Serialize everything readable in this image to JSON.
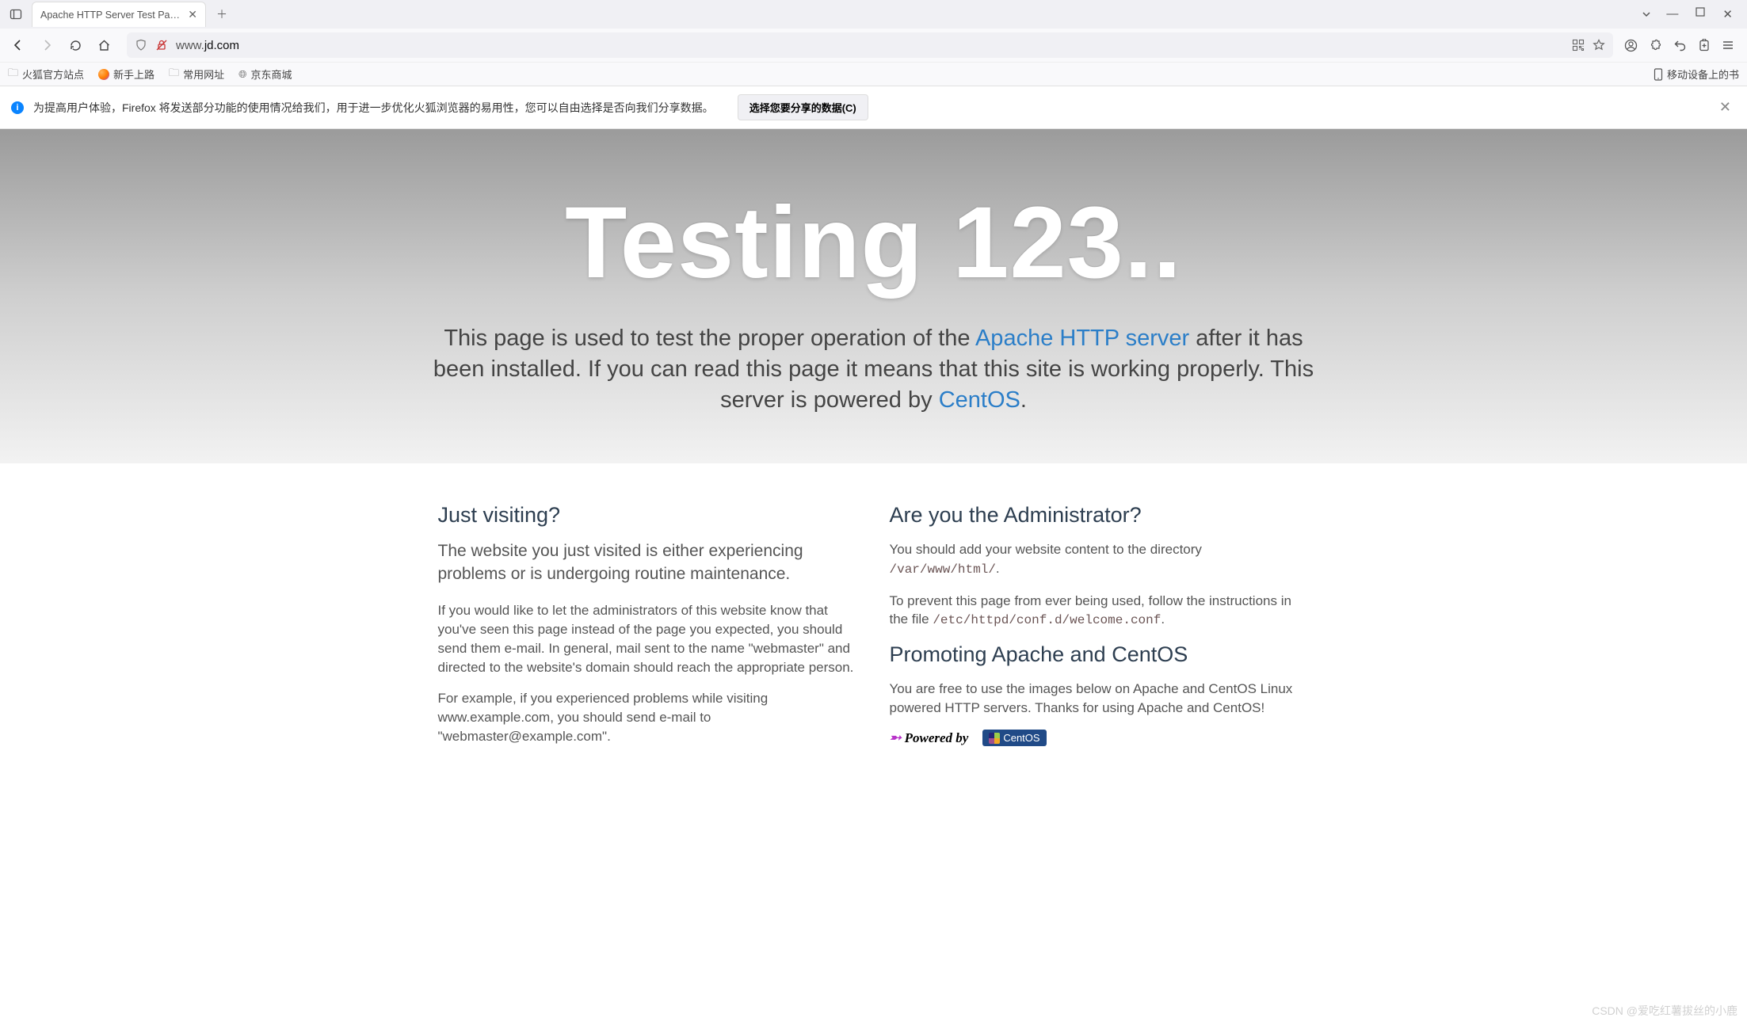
{
  "browser": {
    "tab_title": "Apache HTTP Server Test Page p",
    "url_prefix": "www.",
    "url_domain": "jd.com",
    "bookmarks": {
      "b1": "火狐官方站点",
      "b2": "新手上路",
      "b3": "常用网址",
      "b4": "京东商城",
      "right": "移动设备上的书"
    },
    "notification": {
      "text": "为提高用户体验，Firefox 将发送部分功能的使用情况给我们，用于进一步优化火狐浏览器的易用性，您可以自由选择是否向我们分享数据。",
      "button": "选择您要分享的数据(C)"
    }
  },
  "page": {
    "hero_title": "Testing 123..",
    "lead_1": "This page is used to test the proper operation of the ",
    "lead_link1": "Apache HTTP server",
    "lead_2": " after it has been installed. If you can read this page it means that this site is working properly. This server is powered by ",
    "lead_link2": "CentOS",
    "lead_3": ".",
    "left": {
      "h2": "Just visiting?",
      "sub": "The website you just visited is either experiencing problems or is undergoing routine maintenance.",
      "p1": "If you would like to let the administrators of this website know that you've seen this page instead of the page you expected, you should send them e-mail. In general, mail sent to the name \"webmaster\" and directed to the website's domain should reach the appropriate person.",
      "p2": "For example, if you experienced problems while visiting www.example.com, you should send e-mail to \"webmaster@example.com\"."
    },
    "right": {
      "h2": "Are you the Administrator?",
      "p1a": "You should add your website content to the directory ",
      "p1code": "/var/www/html/",
      "p1b": ".",
      "p2a": "To prevent this page from ever being used, follow the instructions in the file ",
      "p2code": "/etc/httpd/conf.d/welcome.conf",
      "p2b": ".",
      "h2b": "Promoting Apache and CentOS",
      "p3": "You are free to use the images below on Apache and CentOS Linux powered HTTP servers. Thanks for using Apache and CentOS!",
      "powered_by": "Powered by",
      "centos_label": "CentOS"
    }
  },
  "watermark": "CSDN @爱吃红薯拔丝的小鹿"
}
